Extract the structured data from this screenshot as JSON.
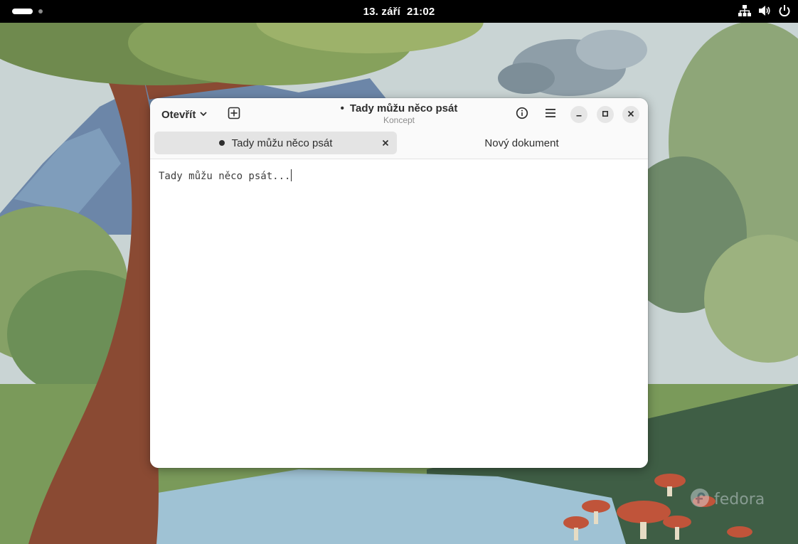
{
  "topbar": {
    "date": "13. září",
    "time": "21:02",
    "icons": [
      "network-wired-icon",
      "volume-icon",
      "power-icon"
    ]
  },
  "window": {
    "open_label": "Otevřít",
    "title": "Tady můžu něco psát",
    "subtitle": "Koncept",
    "title_bullet": "•",
    "tabs": [
      {
        "label": "Tady můžu něco psát",
        "modified": true,
        "active": true
      },
      {
        "label": "Nový dokument",
        "modified": false,
        "active": false
      }
    ],
    "editor_text": "Tady můžu něco psát..."
  },
  "watermark": {
    "text": "fedora"
  },
  "colors": {
    "topbar_bg": "#000000",
    "window_bg": "#ffffff",
    "headerbar_bg": "#fafafa",
    "active_tab_bg": "#e4e4e4",
    "text": "#2e2e2e"
  }
}
